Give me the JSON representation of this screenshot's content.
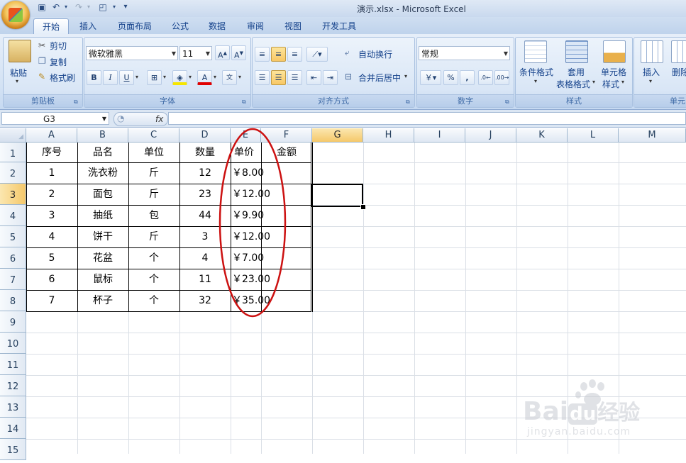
{
  "window": {
    "title": "演示.xlsx - Microsoft Excel"
  },
  "tabs": [
    "开始",
    "插入",
    "页面布局",
    "公式",
    "数据",
    "审阅",
    "视图",
    "开发工具"
  ],
  "active_tab": "开始",
  "clipboard": {
    "paste": "粘贴",
    "cut": "剪切",
    "copy": "复制",
    "format_painter": "格式刷",
    "group": "剪贴板"
  },
  "font": {
    "name": "微软雅黑",
    "size": "11",
    "bold": "B",
    "italic": "I",
    "underline": "U",
    "group": "字体"
  },
  "alignment": {
    "wrap": "自动换行",
    "merge": "合并后居中",
    "group": "对齐方式"
  },
  "number": {
    "format": "常规",
    "percent": "%",
    "comma": ",",
    "group": "数字"
  },
  "styles": {
    "conditional": "条件格式",
    "table_line1": "套用",
    "table_line2": "表格格式",
    "cell_line1": "单元格",
    "cell_line2": "样式",
    "group": "样式"
  },
  "cells_group": {
    "insert": "插入",
    "delete": "删除",
    "group": "单元"
  },
  "formula_bar": {
    "name_box": "G3",
    "fx": "fx",
    "value": ""
  },
  "columns": [
    "A",
    "B",
    "C",
    "D",
    "E",
    "F",
    "G",
    "H",
    "I",
    "J",
    "K",
    "L",
    "M"
  ],
  "rows": [
    "1",
    "2",
    "3",
    "4",
    "5",
    "6",
    "7",
    "8",
    "9",
    "10",
    "11",
    "12",
    "13",
    "14",
    "15"
  ],
  "selected_cell": "G3",
  "table": {
    "headers": [
      "序号",
      "品名",
      "单位",
      "数量",
      "单价",
      "金额"
    ],
    "rows": [
      [
        "1",
        "洗衣粉",
        "斤",
        "12",
        "￥8.00",
        ""
      ],
      [
        "2",
        "面包",
        "斤",
        "23",
        "￥12.00",
        ""
      ],
      [
        "3",
        "抽纸",
        "包",
        "44",
        "￥9.90",
        ""
      ],
      [
        "4",
        "饼干",
        "斤",
        "3",
        "￥12.00",
        ""
      ],
      [
        "5",
        "花盆",
        "个",
        "4",
        "￥7.00",
        ""
      ],
      [
        "6",
        "鼠标",
        "个",
        "11",
        "￥23.00",
        ""
      ],
      [
        "7",
        "杯子",
        "个",
        "32",
        "￥35.00",
        ""
      ]
    ]
  },
  "annotation_color": "#cc1111",
  "watermark": {
    "line1": "Bai",
    "line1b": "du",
    "line1c": "经验",
    "line2": "jingyan.baidu.com"
  }
}
